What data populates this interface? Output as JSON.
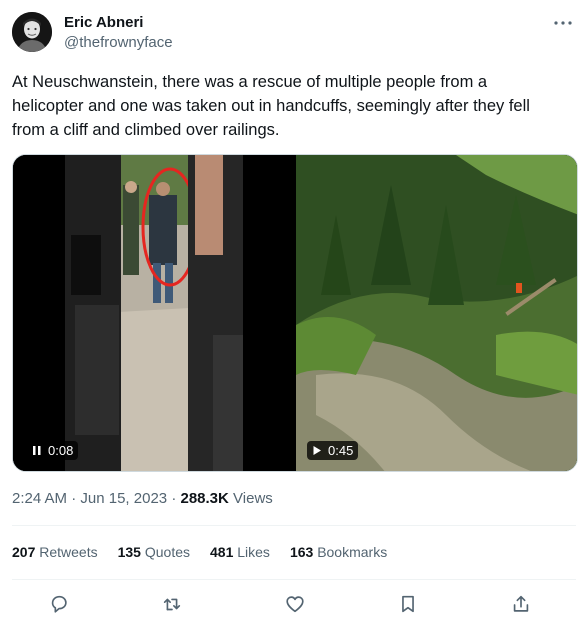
{
  "author": {
    "display_name": "Eric Abneri",
    "handle": "@thefrownyface",
    "avatar_icon": "avatar-portrait"
  },
  "more_icon": "more-horizontal-icon",
  "tweet": {
    "text": "At Neuschwanstein, there was a rescue of multiple people from a helicopter and one was taken out in handcuffs, seemingly after they fell from a cliff and climbed over railings."
  },
  "media": [
    {
      "kind": "video",
      "state": "playing",
      "icon": "pause-icon",
      "duration": "0:08"
    },
    {
      "kind": "video",
      "state": "paused",
      "icon": "play-icon",
      "duration": "0:45"
    }
  ],
  "meta": {
    "time": "2:24 AM",
    "separator": "·",
    "date": "Jun 15, 2023",
    "views_count": "288.3K",
    "views_label": "Views"
  },
  "stats": [
    {
      "count": "207",
      "label": "Retweets"
    },
    {
      "count": "135",
      "label": "Quotes"
    },
    {
      "count": "481",
      "label": "Likes"
    },
    {
      "count": "163",
      "label": "Bookmarks"
    }
  ],
  "actions": [
    "reply-icon",
    "retweet-icon",
    "like-icon",
    "bookmark-icon",
    "share-icon"
  ],
  "colors": {
    "text_primary": "#0f1419",
    "text_secondary": "#536471",
    "divider": "#eff3f4"
  }
}
